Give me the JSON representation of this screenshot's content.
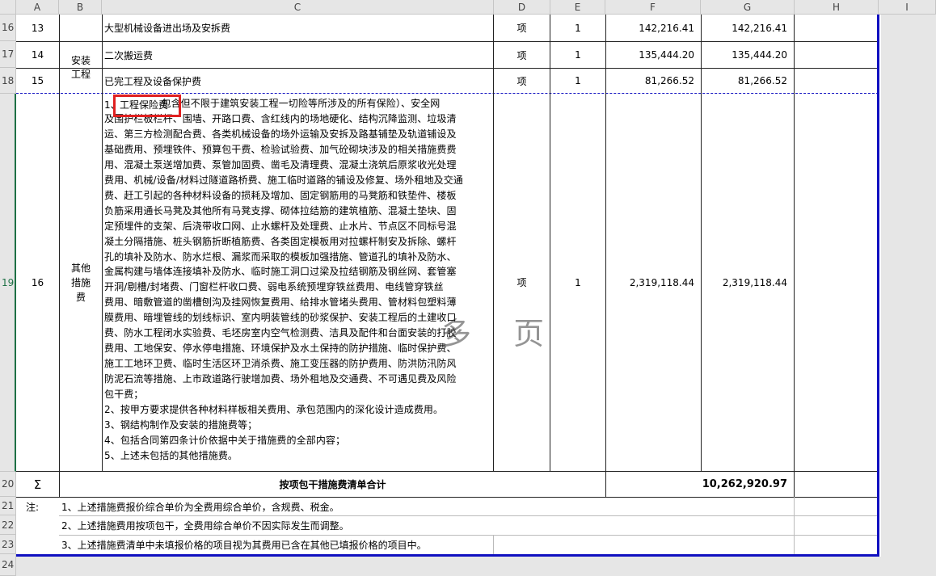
{
  "columns": [
    "A",
    "B",
    "C",
    "D",
    "E",
    "F",
    "G",
    "H",
    "I"
  ],
  "row_numbers": [
    "16",
    "17",
    "18",
    "19",
    "20",
    "21",
    "22",
    "23",
    "24"
  ],
  "rows": [
    {
      "no": "13",
      "item": "大型机械设备进出场及安拆费",
      "unit": "项",
      "qty": "1",
      "price": "142,216.41",
      "total": "142,216.41"
    },
    {
      "no": "14",
      "item": "二次搬运费",
      "unit": "项",
      "qty": "1",
      "price": "135,444.20",
      "total": "135,444.20"
    },
    {
      "no": "15",
      "item": "已完工程及设备保护费",
      "unit": "项",
      "qty": "1",
      "price": "81,266.52",
      "total": "81,266.52"
    },
    {
      "no": "16",
      "unit": "项",
      "qty": "1",
      "price": "2,319,118.44",
      "total": "2,319,118.44"
    }
  ],
  "category_install": "安装\n工程",
  "category_other": "其他\n措施\n费",
  "row16_lead": "1、",
  "row16_highlight": "工程保险费",
  "row16_text": "                  包含但不限于建筑安装工程一切险等所涉及的所有保险）、安全网\n及围护栏板栏杆、围墙、开路口费、含红线内的场地硬化、结构沉降监测、垃圾清\n运、第三方检测配合费、各类机械设备的场外运输及安拆及路基铺垫及轨道铺设及\n基础费用、预埋铁件、预算包干费、检验试验费、加气砼砌块涉及的相关措施费费\n用、混凝土泵送增加费、泵管加固费、凿毛及清理费、混凝土浇筑后原浆收光处理\n费用、机械/设备/材料过隧道路桥费、施工临时道路的铺设及修复、场外租地及交通\n费、赶工引起的各种材料设备的损耗及增加、固定钢筋用的马凳筋和铁垫件、楼板\n负筋采用通长马凳及其他所有马凳支撑、砌体拉结筋的建筑植筋、混凝土垫块、固\n定预埋件的支架、后浇带收口网、止水螺杆及处理费、止水片、节点区不同标号混\n凝土分隔措施、桩头钢筋折断植筋费、各类固定模板用对拉螺杆制安及拆除、螺杆\n孔的填补及防水、防水烂根、漏浆而采取的模板加强措施、管道孔的填补及防水、\n金属构建与墙体连接填补及防水、临时施工洞口过梁及拉结钢筋及钢丝网、套管塞\n开洞/剔槽/封堵费、门窗栏杆收口费、弱电系统预埋穿铁丝费用、电线管穿铁丝\n费用、暗敷管道的凿槽刨沟及挂网恢复费用、给排水管堵头费用、管材料包塑料薄\n膜费用、暗埋管线的划线标识、室内明装管线的砂浆保护、安装工程后的土建收口\n费、防水工程闭水实验费、毛坯房室内空气检测费、洁具及配件和台面安装的打胶\n费用、工地保安、停水停电措施、环境保护及水土保持的防护措施、临时保护费、\n施工工地环卫费、临时生活区环卫消杀费、施工变压器的防护费用、防洪防汛防风\n防泥石流等措施、上市政道路行驶增加费、场外租地及交通费、不可遇见费及风险\n包干费；\n2、按甲方要求提供各种材料样板相关费用、承包范围内的深化设计造成费用。\n3、钢结构制作及安装的措施费等；\n4、包括合同第四条计价依据中关于措施费的全部内容；\n5、上述未包括的其他措施费。",
  "watermark": "多 页",
  "sigma": "Σ",
  "sum_label": "按项包干措施费清单合计",
  "sum_total": "10,262,920.97",
  "notes_label": "注:",
  "notes": [
    "1、上述措施费报价综合单价为全费用综合单价，含规费、税金。",
    "2、上述措施费用按项包干，全费用综合单价不因实际发生而调整。",
    "3、上述措施费清单中未填报价格的项目视为其费用已含在其他已填报价格的项目中。"
  ],
  "colors": {
    "border_blue": "#1010c0",
    "highlight_red": "#e02020",
    "header_grey": "#e6e6e6"
  }
}
